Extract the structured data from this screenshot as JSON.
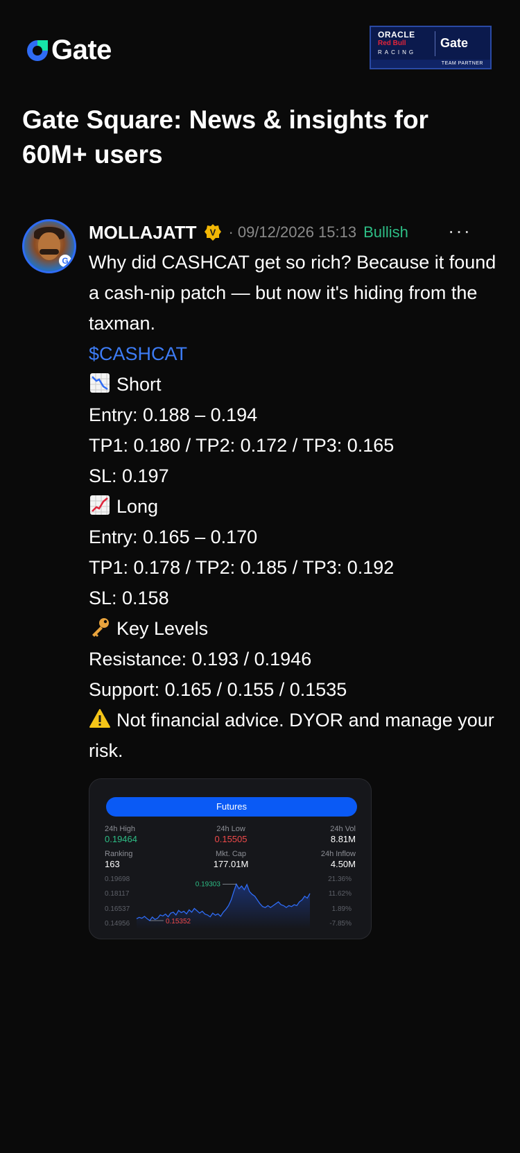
{
  "header": {
    "logo_text": "Gate",
    "partner": {
      "oracle": "ORACLE",
      "redbull": "Red Bull",
      "racing": "RACING",
      "gate": "Gate",
      "team_partner": "TEAM PARTNER"
    }
  },
  "page_title": "Gate Square: News & insights for 60M+ users",
  "post": {
    "username": "MOLLAJATT",
    "verified_letter": "V",
    "separator": "·",
    "date": "09/12/2026 15:13",
    "sentiment": "Bullish",
    "more": "···",
    "lines": {
      "intro": "Why did CASHCAT get so rich? Because it found a cash-nip patch — but now it's hiding from the taxman.",
      "ticker": "$CASHCAT",
      "short_label": "Short",
      "short_entry": "Entry: 0.188 – 0.194",
      "short_tp": "TP1: 0.180 / TP2: 0.172 / TP3: 0.165",
      "short_sl": "SL: 0.197",
      "long_label": "Long",
      "long_entry": "Entry: 0.165 – 0.170",
      "long_tp": "TP1: 0.178 / TP2: 0.185 / TP3: 0.192",
      "long_sl": "SL: 0.158",
      "key_label": "Key Levels",
      "resistance": "Resistance: 0.193 / 0.1946",
      "support": "Support: 0.165 / 0.155 / 0.1535",
      "disclaimer": "Not financial advice. DYOR and manage your risk."
    },
    "icons": {
      "short": "chart-decreasing-icon",
      "long": "chart-increasing-icon",
      "key": "key-icon",
      "warning": "warning-icon"
    }
  },
  "card": {
    "futures_label": "Futures",
    "stats": {
      "high_label": "24h High",
      "high_value": "0.19464",
      "low_label": "24h Low",
      "low_value": "0.15505",
      "vol_label": "24h Vol",
      "vol_value": "8.81M",
      "rank_label": "Ranking",
      "rank_value": "163",
      "cap_label": "Mkt. Cap",
      "cap_value": "177.01M",
      "inflow_label": "24h Inflow",
      "inflow_value": "4.50M"
    },
    "y_left": [
      "0.19698",
      "0.18117",
      "0.16537",
      "0.14956"
    ],
    "y_right": [
      "21.36%",
      "11.62%",
      "1.89%",
      "-7.85%"
    ],
    "max_label": "0.19303",
    "min_label": "0.15352"
  },
  "chart_data": {
    "type": "line",
    "yaxis_left": [
      0.19698,
      0.18117,
      0.16537,
      0.14956
    ],
    "yaxis_right": [
      "21.36%",
      "11.62%",
      "1.89%",
      "-7.85%"
    ],
    "ylim": [
      0.14956,
      0.19698
    ],
    "annotations": {
      "max": 0.19303,
      "min": 0.15352
    },
    "values": [
      0.156,
      0.1575,
      0.1565,
      0.1585,
      0.156,
      0.154,
      0.1578,
      0.1552,
      0.1565,
      0.16,
      0.159,
      0.161,
      0.158,
      0.162,
      0.163,
      0.16,
      0.1648,
      0.1625,
      0.164,
      0.1612,
      0.1655,
      0.163,
      0.167,
      0.1645,
      0.162,
      0.164,
      0.161,
      0.16,
      0.158,
      0.162,
      0.1598,
      0.1612,
      0.1585,
      0.163,
      0.166,
      0.17,
      0.176,
      0.185,
      0.193,
      0.188,
      0.191,
      0.187,
      0.1925,
      0.185,
      0.182,
      0.18,
      0.176,
      0.172,
      0.169,
      0.168,
      0.17,
      0.168,
      0.17,
      0.172,
      0.174,
      0.171,
      0.17,
      0.168,
      0.17,
      0.169,
      0.171,
      0.17,
      0.174,
      0.176,
      0.18,
      0.178,
      0.183
    ]
  }
}
